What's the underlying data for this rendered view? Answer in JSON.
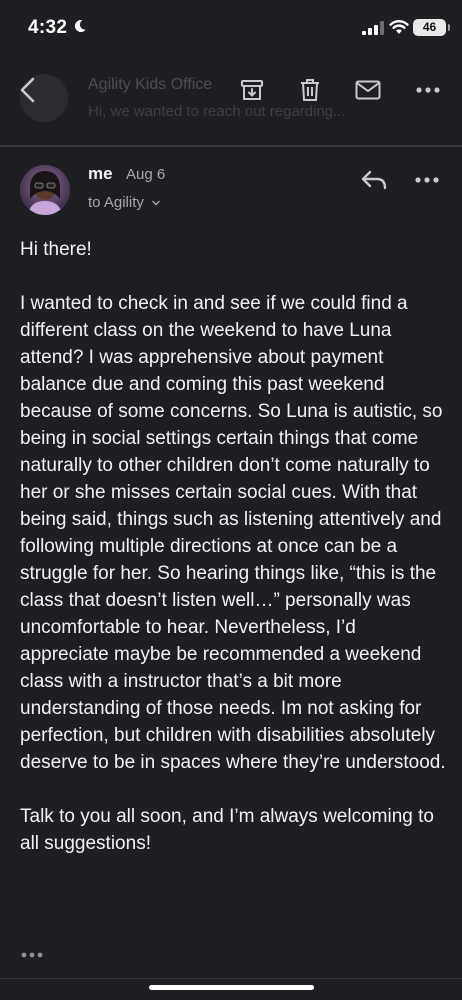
{
  "status_bar": {
    "time": "4:32",
    "battery": "46",
    "icons": [
      "moon-icon",
      "signal-icon",
      "wifi-icon",
      "battery-icon"
    ]
  },
  "toolbar": {
    "icons": [
      "back-icon",
      "archive-icon",
      "trash-icon",
      "mail-icon",
      "more-icon"
    ]
  },
  "previous_message": {
    "from": "Agility Kids Office",
    "snippet": "Hi, we wanted to reach out regarding..."
  },
  "message": {
    "sender": "me",
    "date": "Aug 6",
    "recipients": "to Agility",
    "greeting": "Hi there!",
    "body": "I wanted to check in and see if we could find a different class on the weekend to have Luna attend? I was apprehensive about payment balance due and coming this past weekend because of some concerns. So Luna is autistic, so being in social settings certain things that come naturally to other children don’t come naturally to her or she misses certain social cues. With that being said, things such as listening attentively and following multiple directions at once can be a struggle for her. So hearing things like, “this is the class that doesn’t listen well…” personally was uncomfortable to hear. Nevertheless, I’d appreciate maybe be recommended a weekend class with a instructor that’s a bit more understanding of those needs. Im not asking for perfection, but children with disabilities absolutely deserve to be in spaces where they’re understood.",
    "closing": "Talk to you all soon, and I’m always welcoming to all suggestions!"
  },
  "colors": {
    "background": "#1e1f22",
    "text": "#f2f2f4",
    "secondary_text": "#a7a8ad",
    "icon": "#c9cacf"
  }
}
